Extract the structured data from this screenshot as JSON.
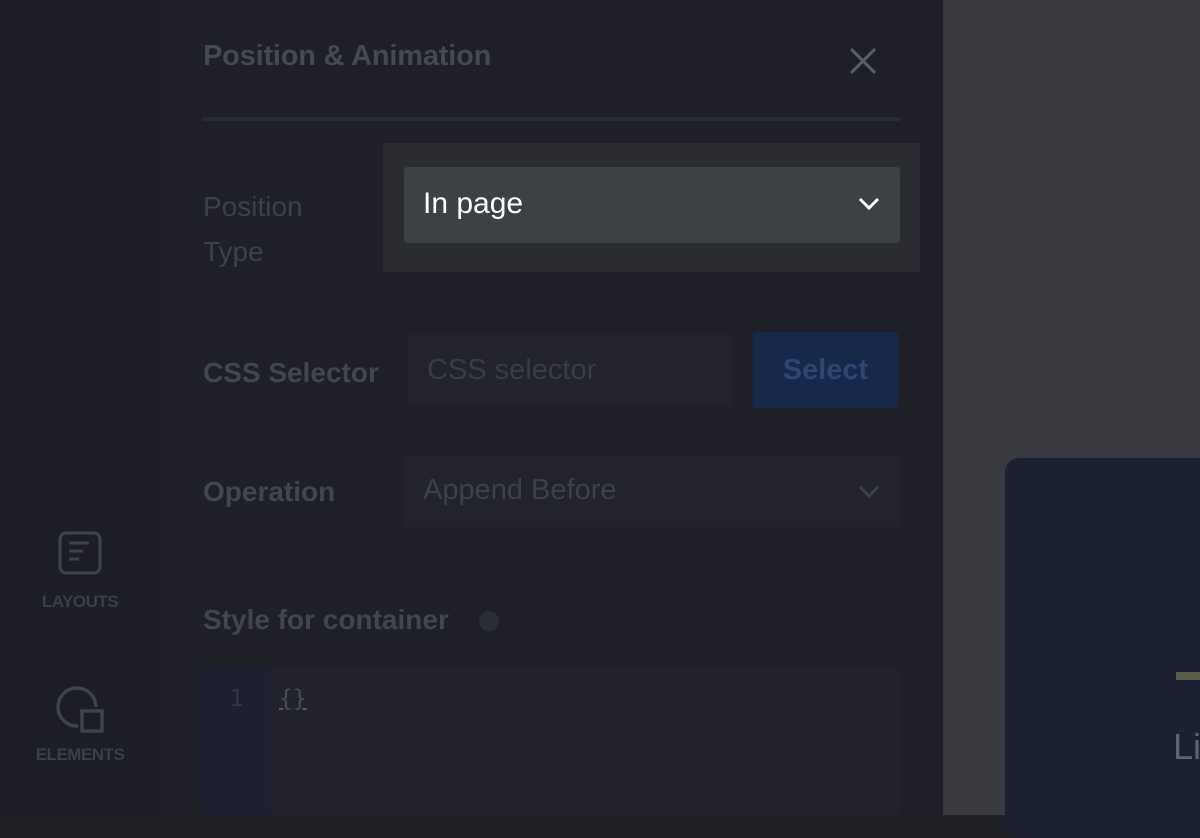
{
  "sidebar": {
    "items": [
      {
        "label": "LAYOUTS",
        "icon": "layout-document-icon"
      },
      {
        "label": "ELEMENTS",
        "icon": "elements-shapes-icon"
      }
    ]
  },
  "panel": {
    "title": "Position & Animation",
    "close_icon": "close-icon",
    "fields": {
      "position_type": {
        "label_line1": "Position",
        "label_line2": "Type",
        "value": "In page"
      },
      "css_selector": {
        "label": "CSS Selector",
        "placeholder": "CSS selector",
        "value": "",
        "button_label": "Select"
      },
      "operation": {
        "label": "Operation",
        "value": "Append Before"
      },
      "style_container": {
        "label": "Style for container",
        "info_icon": "info-icon",
        "line_number": "1",
        "code": "{}"
      }
    }
  },
  "canvas": {
    "preview_text": "Li"
  },
  "colors": {
    "panel_bg": "#1e1f27",
    "highlight_select_bg": "#3c4145",
    "select_button_bg": "#17294a",
    "canvas_bg": "#393a40"
  }
}
